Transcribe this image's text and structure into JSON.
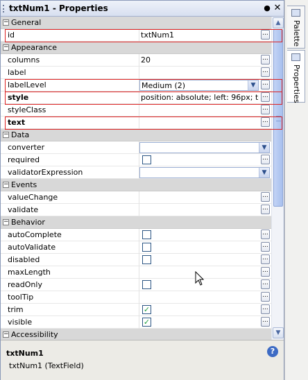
{
  "window": {
    "title": "txtNum1 - Properties",
    "dot_glyph": "●",
    "close_glyph": "✕"
  },
  "glyphs": {
    "ellipsis": "...",
    "minus": "−",
    "check": "✓",
    "dropdown": "▼",
    "scroll_up": "▲",
    "scroll_down": "▼"
  },
  "sections": [
    {
      "name": "General",
      "rows": [
        {
          "label": "id",
          "value": "txtNum1",
          "editor": "text",
          "ellipsis": true,
          "highlighted": true
        }
      ]
    },
    {
      "name": "Appearance",
      "rows": [
        {
          "label": "columns",
          "value": "20",
          "editor": "text",
          "ellipsis": true
        },
        {
          "label": "label",
          "value": "",
          "editor": "text",
          "ellipsis": true
        },
        {
          "label": "labelLevel",
          "value": "Medium (2)",
          "editor": "combo-inline",
          "ellipsis": true,
          "highlighted": true
        },
        {
          "label": "style",
          "value": "position: absolute; left: 96px; to...",
          "editor": "text",
          "ellipsis": true,
          "bold": true,
          "highlighted": true
        },
        {
          "label": "styleClass",
          "value": "",
          "editor": "text",
          "ellipsis": true
        },
        {
          "label": "text",
          "value": "",
          "editor": "text",
          "ellipsis": true,
          "bold": true,
          "highlighted": true
        }
      ]
    },
    {
      "name": "Data",
      "rows": [
        {
          "label": "converter",
          "value": "",
          "editor": "combo"
        },
        {
          "label": "required",
          "editor": "checkbox",
          "checked": false,
          "ellipsis": true
        },
        {
          "label": "validatorExpression",
          "value": "",
          "editor": "combo"
        }
      ]
    },
    {
      "name": "Events",
      "rows": [
        {
          "label": "valueChange",
          "value": "",
          "editor": "text",
          "ellipsis": true
        },
        {
          "label": "validate",
          "value": "",
          "editor": "text",
          "ellipsis": true
        }
      ]
    },
    {
      "name": "Behavior",
      "rows": [
        {
          "label": "autoComplete",
          "editor": "checkbox",
          "checked": false,
          "ellipsis": true
        },
        {
          "label": "autoValidate",
          "editor": "checkbox",
          "checked": false,
          "ellipsis": true
        },
        {
          "label": "disabled",
          "editor": "checkbox",
          "checked": false,
          "ellipsis": true
        },
        {
          "label": "maxLength",
          "value": "",
          "editor": "text",
          "ellipsis": true
        },
        {
          "label": "readOnly",
          "editor": "checkbox",
          "checked": false,
          "ellipsis": true
        },
        {
          "label": "toolTip",
          "value": "",
          "editor": "text",
          "ellipsis": true
        },
        {
          "label": "trim",
          "editor": "checkbox",
          "checked": true,
          "ellipsis": true
        },
        {
          "label": "visible",
          "editor": "checkbox",
          "checked": true,
          "ellipsis": true
        }
      ]
    },
    {
      "name": "Accessibility",
      "rows": []
    }
  ],
  "description": {
    "title": "txtNum1",
    "text": "txtNum1 (TextField)"
  },
  "side_tabs": [
    {
      "label": "Palette"
    },
    {
      "label": "Properties"
    }
  ],
  "colors": {
    "highlight": "#dd2222",
    "category_bg": "#d8d8d8",
    "check": "#1f9d3f"
  }
}
